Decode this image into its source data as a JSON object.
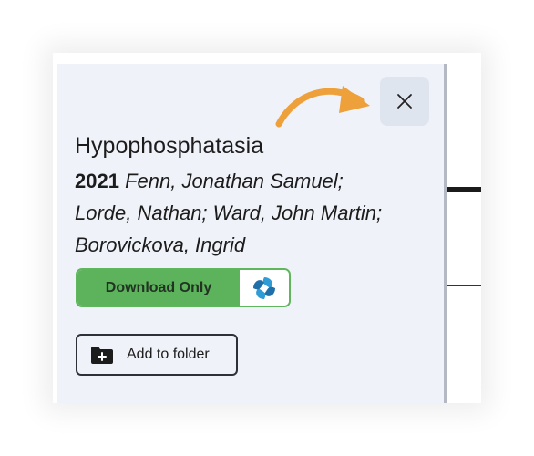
{
  "dialog": {
    "title": "Hypophosphatasia",
    "year": "2021",
    "authors": "Fenn, Jonathan Samuel; Lorde, Nathan; Ward, John Martin; Borovickova, Ingrid",
    "close_icon": "close-icon"
  },
  "actions": {
    "download_label": "Download Only",
    "download_icon": "swirl-logo-icon",
    "add_folder_label": "Add to folder",
    "add_folder_icon": "folder-plus-icon"
  },
  "colors": {
    "panel_bg": "#eff2f8",
    "download_green": "#5cb35b",
    "arrow_orange": "#eea13b",
    "logo_blue": "#2f9cd6"
  }
}
